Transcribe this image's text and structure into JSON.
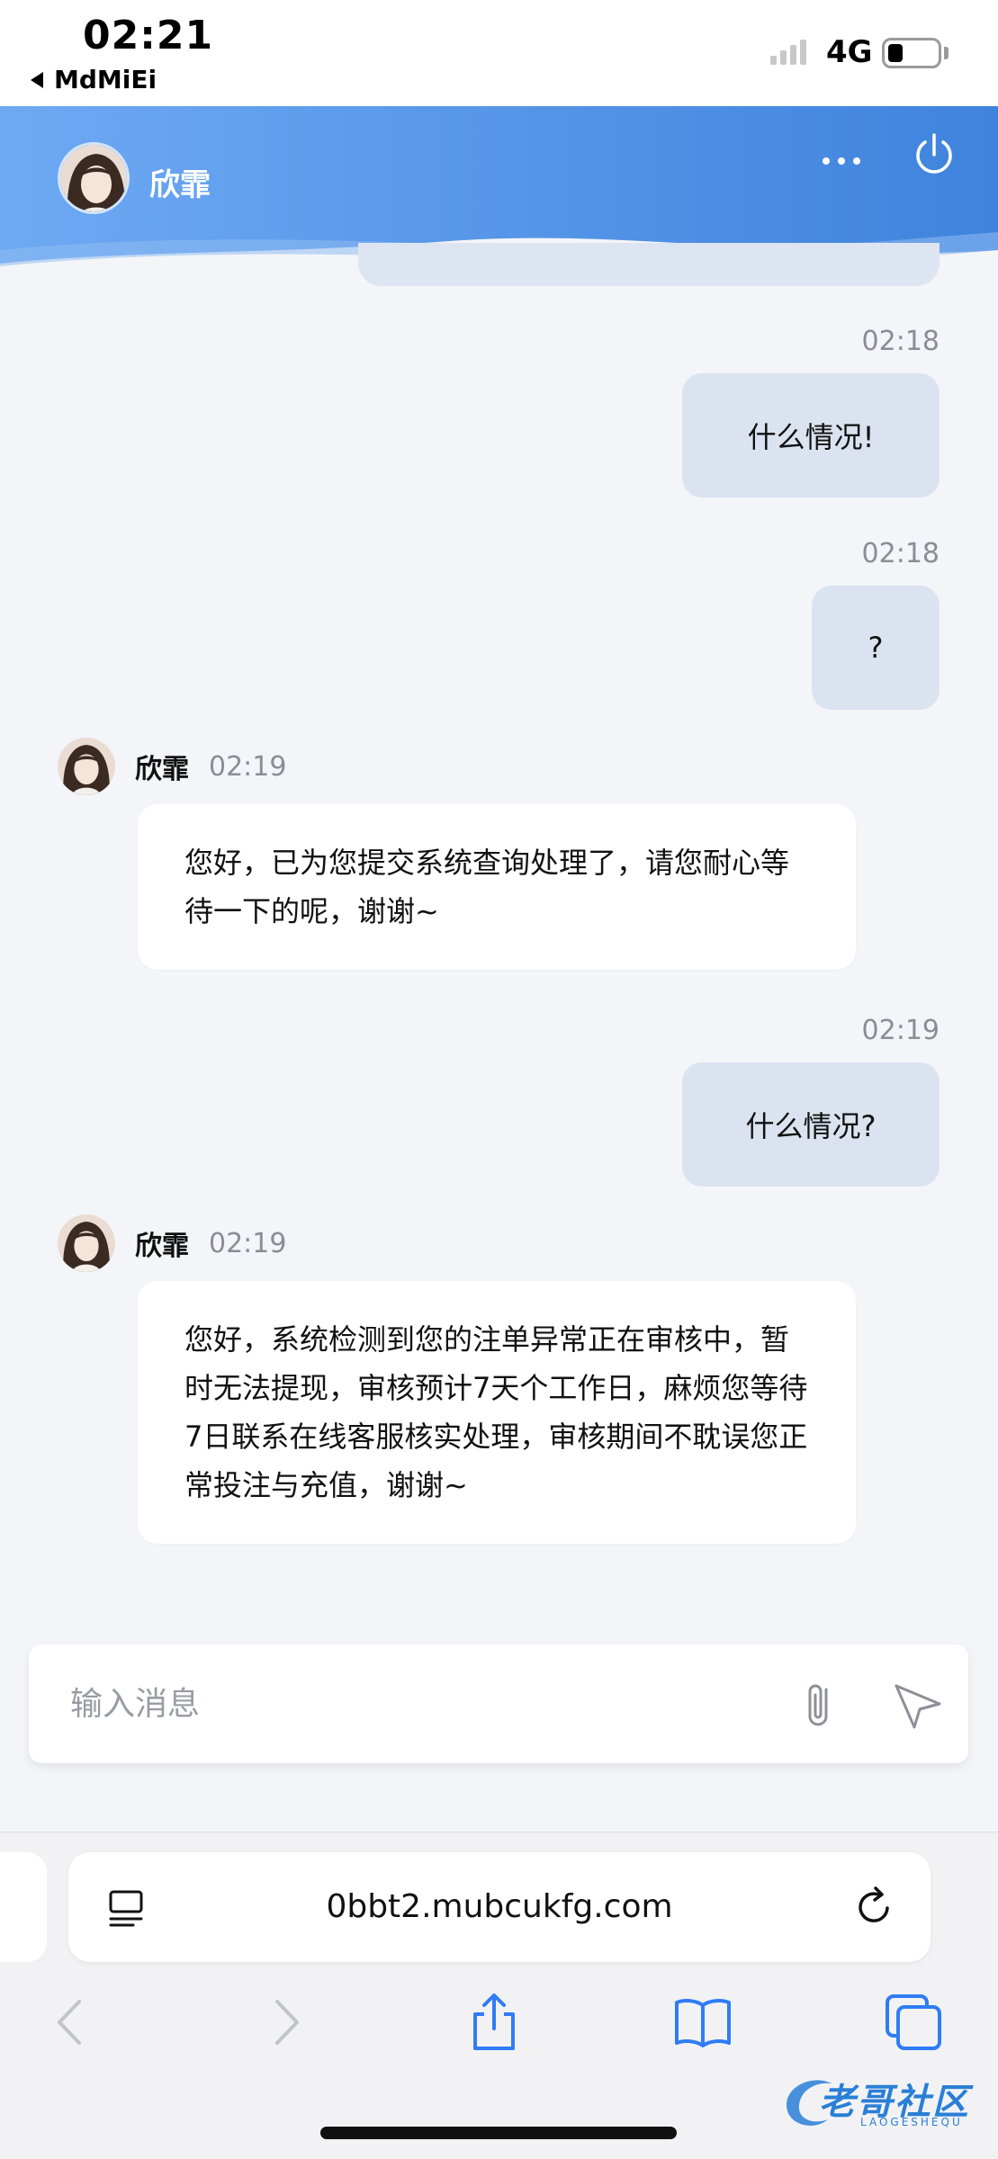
{
  "status_bar": {
    "time": "02:21",
    "back_app": "MdMiEi",
    "network": "4G"
  },
  "header": {
    "agent_name": "欣霏"
  },
  "messages": [
    {
      "direction": "out",
      "time": "02:18",
      "text": "什么情况!"
    },
    {
      "direction": "out",
      "time": "02:18",
      "text": "?"
    },
    {
      "direction": "in",
      "sender": "欣霏",
      "time": "02:19",
      "text": "您好，已为您提交系统查询处理了，请您耐心等待一下的呢，谢谢~"
    },
    {
      "direction": "out",
      "time": "02:19",
      "text": "什么情况?"
    },
    {
      "direction": "in",
      "sender": "欣霏",
      "time": "02:19",
      "text": "您好，系统检测到您的注单异常正在审核中，暂时无法提现，审核预计7天个工作日，麻烦您等待7日联系在线客服核实处理，审核期间不耽误您正常投注与充值，谢谢~"
    }
  ],
  "input": {
    "placeholder": "输入消息"
  },
  "browser": {
    "url": "0bbt2.mubcukfg.com"
  },
  "watermark": {
    "text": "老哥社区",
    "sub": "LAOGESHEQU"
  },
  "colors": {
    "header_gradient_start": "#6da7f2",
    "header_gradient_end": "#3f84de",
    "outgoing_bubble": "#dbe3f1",
    "incoming_bubble": "#ffffff",
    "safari_accent": "#2f7cf6"
  },
  "icons": [
    "more-icon",
    "power-icon",
    "attachment-icon",
    "send-icon",
    "reader-icon",
    "reload-icon",
    "back-icon",
    "forward-icon",
    "share-icon",
    "bookmarks-icon",
    "tabs-icon"
  ]
}
